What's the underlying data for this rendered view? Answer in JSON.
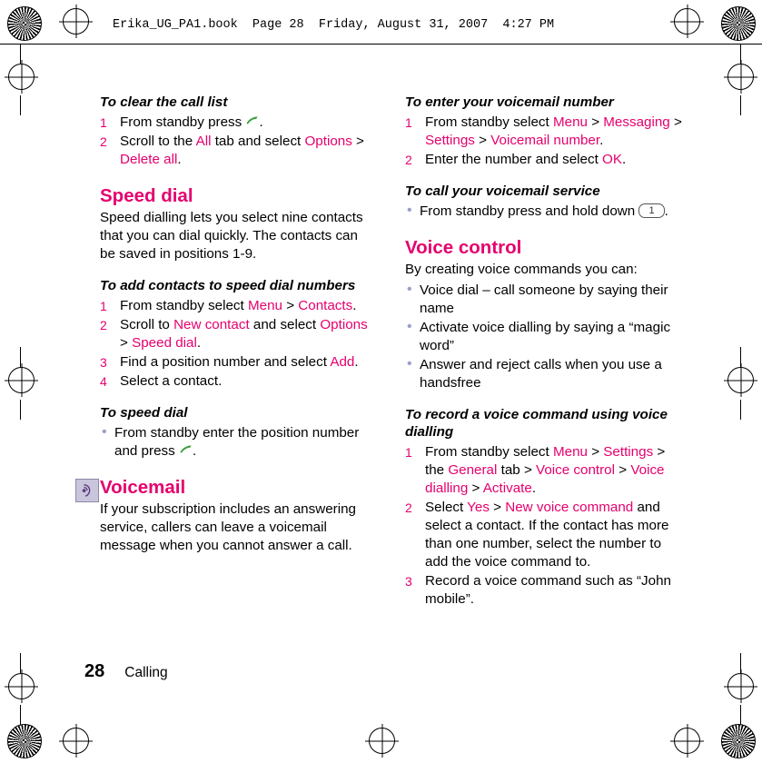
{
  "header": {
    "running_head": "Erika_UG_PA1.book  Page 28  Friday, August 31, 2007  4:27 PM"
  },
  "footer": {
    "page_number": "28",
    "chapter": "Calling"
  },
  "colors": {
    "accent": "#e5006e",
    "bullet": "#9aa0c8",
    "icon_bg": "#c9c5dc"
  },
  "left_column": {
    "blocks": [
      {
        "type": "subheading",
        "text": "To clear the call list"
      },
      {
        "type": "steps",
        "items": [
          {
            "parts": [
              {
                "t": "From standby press "
              },
              {
                "t": "",
                "icon": "call-key-icon"
              },
              {
                "t": "."
              }
            ]
          },
          {
            "parts": [
              {
                "t": "Scroll to the "
              },
              {
                "t": "All",
                "ui": true
              },
              {
                "t": " tab and select "
              },
              {
                "t": "Options",
                "ui": true
              },
              {
                "t": " > "
              },
              {
                "t": "Delete all",
                "ui": true
              },
              {
                "t": "."
              }
            ]
          }
        ]
      },
      {
        "type": "heading",
        "text": "Speed dial"
      },
      {
        "type": "paragraph",
        "text": "Speed dialling lets you select nine contacts that you can dial quickly. The contacts can be saved in positions 1-9."
      },
      {
        "type": "subheading",
        "text": "To add contacts to speed dial numbers"
      },
      {
        "type": "steps",
        "items": [
          {
            "parts": [
              {
                "t": "From standby select "
              },
              {
                "t": "Menu",
                "ui": true
              },
              {
                "t": " > "
              },
              {
                "t": "Contacts",
                "ui": true
              },
              {
                "t": "."
              }
            ]
          },
          {
            "parts": [
              {
                "t": "Scroll to "
              },
              {
                "t": "New contact",
                "ui": true
              },
              {
                "t": " and select "
              },
              {
                "t": "Options",
                "ui": true
              },
              {
                "t": " > "
              },
              {
                "t": "Speed dial",
                "ui": true
              },
              {
                "t": "."
              }
            ]
          },
          {
            "parts": [
              {
                "t": "Find a position number and select "
              },
              {
                "t": "Add",
                "ui": true
              },
              {
                "t": "."
              }
            ]
          },
          {
            "parts": [
              {
                "t": "Select a contact."
              }
            ]
          }
        ]
      },
      {
        "type": "subheading",
        "text": "To speed dial"
      },
      {
        "type": "bullets",
        "items": [
          {
            "parts": [
              {
                "t": "From standby enter the position number and press "
              },
              {
                "t": "",
                "icon": "call-key-icon"
              },
              {
                "t": "."
              }
            ]
          }
        ]
      },
      {
        "type": "heading_with_icon",
        "text": "Voicemail",
        "icon": "voicemail-icon"
      },
      {
        "type": "paragraph",
        "text": "If your subscription includes an answering service, callers can leave a voicemail message when you cannot answer a call."
      }
    ]
  },
  "right_column": {
    "blocks": [
      {
        "type": "subheading",
        "text": "To enter your voicemail number"
      },
      {
        "type": "steps",
        "items": [
          {
            "parts": [
              {
                "t": "From standby select "
              },
              {
                "t": "Menu",
                "ui": true
              },
              {
                "t": " > "
              },
              {
                "t": "Messaging",
                "ui": true
              },
              {
                "t": " > "
              },
              {
                "t": "Settings",
                "ui": true
              },
              {
                "t": " > "
              },
              {
                "t": "Voicemail number",
                "ui": true
              },
              {
                "t": "."
              }
            ]
          },
          {
            "parts": [
              {
                "t": "Enter the number and select "
              },
              {
                "t": "OK",
                "ui": true
              },
              {
                "t": "."
              }
            ]
          }
        ]
      },
      {
        "type": "subheading",
        "text": "To call your voicemail service"
      },
      {
        "type": "bullets",
        "items": [
          {
            "parts": [
              {
                "t": "From standby press and hold down "
              },
              {
                "t": "1",
                "keycap": true
              },
              {
                "t": "."
              }
            ]
          }
        ]
      },
      {
        "type": "heading",
        "text": "Voice control"
      },
      {
        "type": "paragraph",
        "text": "By creating voice commands you can:"
      },
      {
        "type": "bullets",
        "items": [
          {
            "parts": [
              {
                "t": "Voice dial – call someone by saying their name"
              }
            ]
          },
          {
            "parts": [
              {
                "t": "Activate voice dialling by saying a “magic word”"
              }
            ]
          },
          {
            "parts": [
              {
                "t": "Answer and reject calls when you use a handsfree"
              }
            ]
          }
        ]
      },
      {
        "type": "subheading",
        "text": "To record a voice command using voice dialling"
      },
      {
        "type": "steps",
        "items": [
          {
            "parts": [
              {
                "t": "From standby select "
              },
              {
                "t": "Menu",
                "ui": true
              },
              {
                "t": " > "
              },
              {
                "t": "Settings",
                "ui": true
              },
              {
                "t": " > the "
              },
              {
                "t": "General",
                "ui": true
              },
              {
                "t": " tab > "
              },
              {
                "t": "Voice control",
                "ui": true
              },
              {
                "t": " > "
              },
              {
                "t": "Voice dialling",
                "ui": true
              },
              {
                "t": " > "
              },
              {
                "t": "Activate",
                "ui": true
              },
              {
                "t": "."
              }
            ]
          },
          {
            "parts": [
              {
                "t": "Select "
              },
              {
                "t": "Yes",
                "ui": true
              },
              {
                "t": " > "
              },
              {
                "t": "New voice command",
                "ui": true
              },
              {
                "t": " and select a contact. If the contact has more than one number, select the number to add the voice command to."
              }
            ]
          },
          {
            "parts": [
              {
                "t": "Record a voice command such as “John mobile”."
              }
            ]
          }
        ]
      }
    ]
  }
}
